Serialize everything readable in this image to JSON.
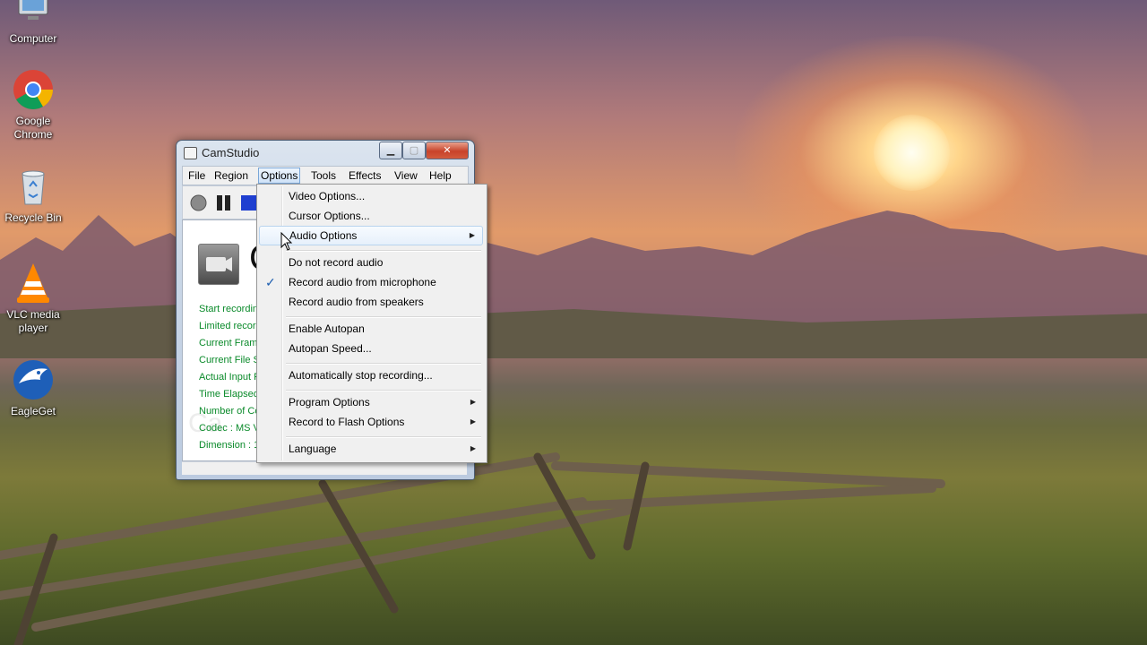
{
  "desktop": {
    "icons": [
      {
        "label": "Computer",
        "icon": "computer-icon"
      },
      {
        "label": "Google Chrome",
        "icon": "chrome-icon"
      },
      {
        "label": "Recycle Bin",
        "icon": "recycle-bin-icon"
      },
      {
        "label": "VLC media player",
        "icon": "vlc-icon"
      },
      {
        "label": "EagleGet",
        "icon": "eagleget-icon"
      }
    ]
  },
  "window": {
    "title": "CamStudio",
    "controls": {
      "minimize": "▁",
      "maximize": "▢",
      "close": "✕"
    },
    "menu": [
      "File",
      "Region",
      "Options",
      "Tools",
      "Effects",
      "View",
      "Help"
    ],
    "active_menu": "Options",
    "toolbar": [
      {
        "name": "record",
        "color": "#8a8a8a"
      },
      {
        "name": "pause",
        "color": "#222222"
      },
      {
        "name": "stop",
        "color": "#1f3fd0"
      }
    ],
    "client": {
      "title_fragment": "C",
      "stats": [
        "Start recording",
        "Limited record",
        "Current Frame",
        "Current File Si",
        "Actual Input F",
        "Time Elapsed",
        "Number of Co",
        "Codec : MS V",
        "Dimension : 1"
      ],
      "watermark": "Ca"
    }
  },
  "options_menu": {
    "groups": [
      [
        {
          "label": "Video Options..."
        },
        {
          "label": "Cursor Options..."
        },
        {
          "label": "Audio Options",
          "submenu": true,
          "highlighted": true
        }
      ],
      [
        {
          "label": "Do not record audio"
        },
        {
          "label": "Record audio from microphone",
          "checked": true
        },
        {
          "label": "Record audio from speakers"
        }
      ],
      [
        {
          "label": "Enable Autopan"
        },
        {
          "label": "Autopan Speed..."
        }
      ],
      [
        {
          "label": "Automatically stop recording..."
        }
      ],
      [
        {
          "label": "Program Options",
          "submenu": true
        },
        {
          "label": "Record to Flash Options",
          "submenu": true
        }
      ],
      [
        {
          "label": "Language",
          "submenu": true
        }
      ]
    ],
    "check_glyph": "✓",
    "arrow_glyph": "▶"
  },
  "colors": {
    "stat_text": "#0a8a2a",
    "menu_highlight_border": "#b9d4ee",
    "close_button": "#c8432a"
  }
}
